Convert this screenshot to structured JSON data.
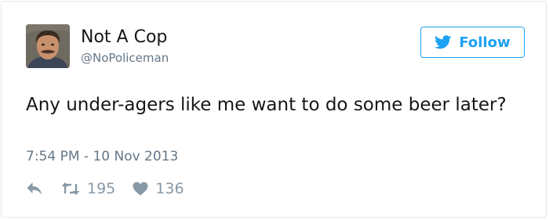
{
  "tweet": {
    "author": {
      "display_name": "Not A Cop",
      "username": "@NoPoliceman"
    },
    "follow_label": "Follow",
    "text": "Any under-agers like me want to do some beer later?",
    "timestamp": "7:54 PM - 10 Nov 2013",
    "stats": {
      "retweets": "195",
      "likes": "136"
    }
  },
  "icons": {
    "follow": "twitter-bird-icon",
    "reply": "reply-icon",
    "retweet": "retweet-icon",
    "like": "heart-icon"
  },
  "colors": {
    "accent": "#1da1f2",
    "text": "#14171a",
    "muted": "#657786",
    "action": "#8899a6",
    "border": "#e1e8ed"
  }
}
